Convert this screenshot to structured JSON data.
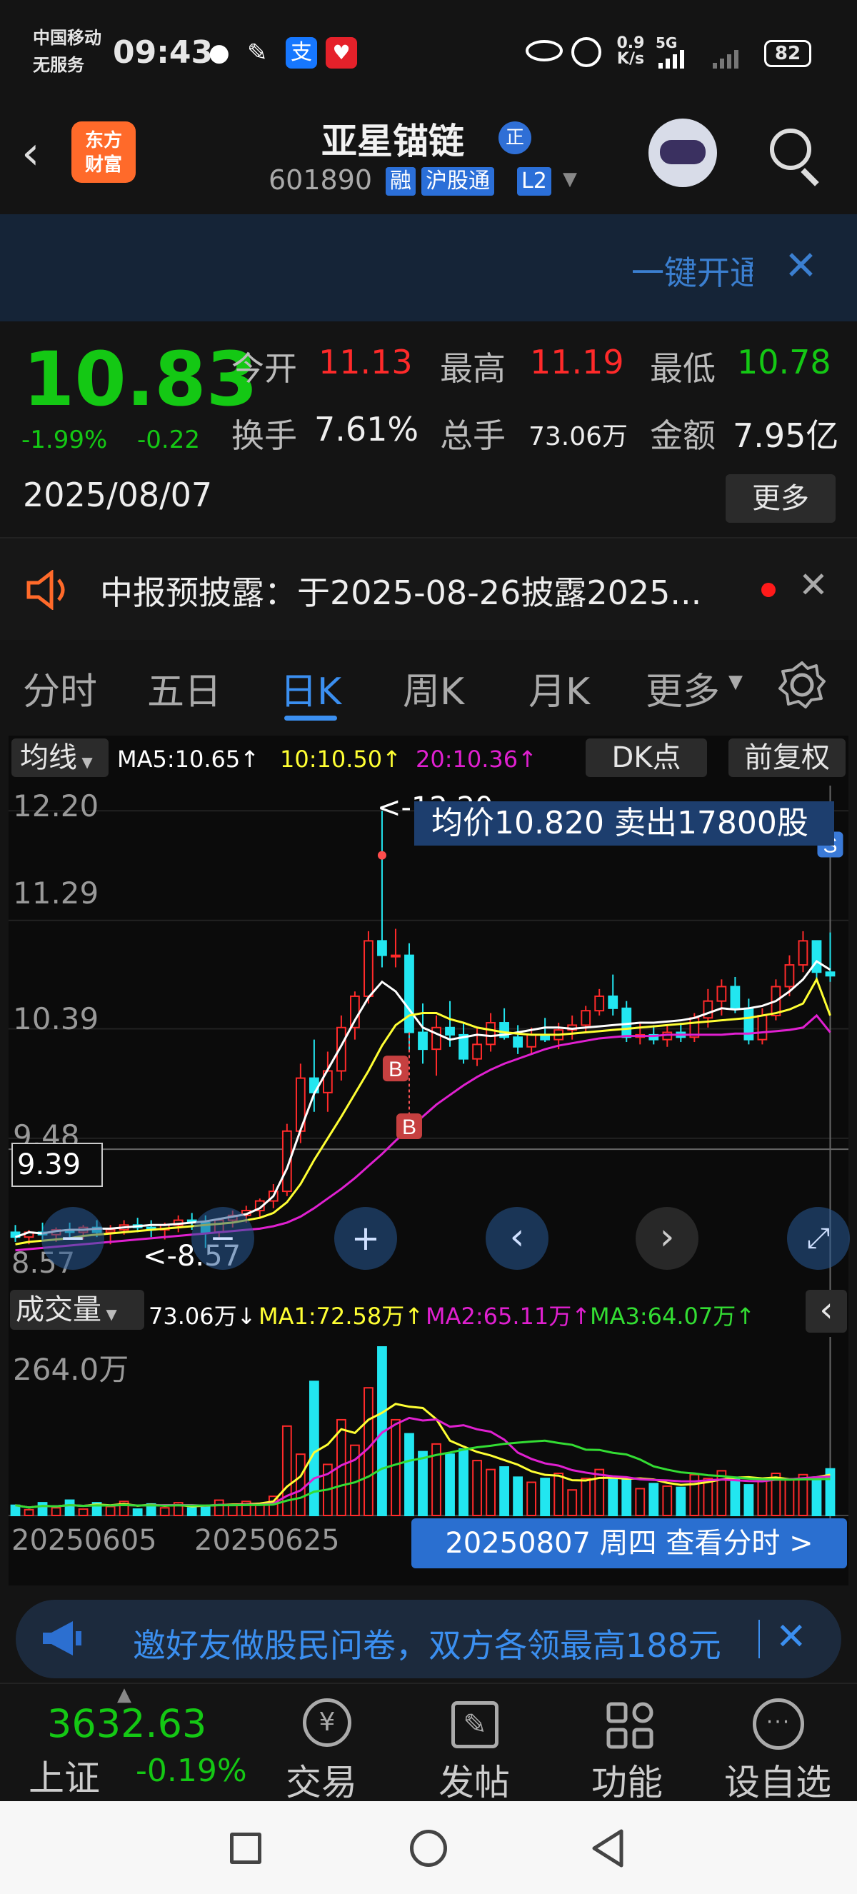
{
  "status": {
    "carrier": "中国移动",
    "service": "无服务",
    "time": "09:43",
    "speed_value": "0.9",
    "speed_unit": "K/s",
    "network": "5G",
    "battery": "82",
    "app_icons": [
      "wechat-icon",
      "feather-icon",
      "alipay-icon",
      "gift-icon"
    ]
  },
  "header": {
    "logo_line1": "东方",
    "logo_line2": "财富",
    "stock_name": "亚星锚链",
    "stock_badge": "正",
    "code": "601890",
    "tags": [
      "融",
      "沪股通",
      "L2"
    ]
  },
  "banner": {
    "text": "一键开通"
  },
  "quote": {
    "price": "10.83",
    "change_pct": "-1.99%",
    "change_amt": "-0.22",
    "open_label": "今开",
    "open": "11.13",
    "high_label": "最高",
    "high": "11.19",
    "low_label": "最低",
    "low": "10.78",
    "turnover_label": "换手",
    "turnover": "7.61%",
    "volume_label": "总手",
    "volume": "73.06万",
    "amount_label": "金额",
    "amount": "7.95亿",
    "date": "2025/08/07",
    "more_button": "更多"
  },
  "notice": {
    "text": "中报预披露：于2025-08-26披露2025..."
  },
  "tabs": [
    "分时",
    "五日",
    "日K",
    "周K",
    "月K",
    "更多"
  ],
  "active_tab": 2,
  "chart_toolbar": {
    "ma_select": "均线",
    "ma5": "MA5:10.65↑",
    "ma10": "10:10.50↑",
    "ma20": "20:10.36↑",
    "dk_button": "DK点",
    "fq_button": "前复权"
  },
  "price_chart": {
    "y_labels": [
      "12.20",
      "11.29",
      "10.39",
      "9.48"
    ],
    "crosshair_label": "9.39",
    "high_marker": "<-12.20",
    "low_marker": "<-8.57",
    "low_axis_label": "8.57",
    "trade_info": "均价10.820  卖出17800股",
    "buy_badge": "B",
    "sell_badge": "S"
  },
  "volume_toolbar": {
    "select": "成交量",
    "vol": "73.06万↓",
    "ma1": "MA1:72.58万↑",
    "ma2": "MA2:65.11万↑",
    "ma3": "MA3:64.07万↑"
  },
  "volume_chart": {
    "y_label": "264.0万"
  },
  "x_axis": {
    "date1": "20250605",
    "date2": "20250625",
    "view_button": "20250807 周四 查看分时 >"
  },
  "promo": {
    "text": "邀好友做股民问卷，双方各领最高188元"
  },
  "bottom_nav": {
    "index_value": "3632.63",
    "index_name": "上证",
    "index_change": "-0.19%",
    "items": [
      "交易",
      "发帖",
      "功能",
      "设自选"
    ]
  },
  "chart_data": {
    "type": "candlestick",
    "title": "",
    "ylim": [
      8.4,
      12.35
    ],
    "series": [
      {
        "name": "MA5",
        "values": [
          8.66,
          8.7,
          8.69,
          8.71,
          8.72,
          8.72,
          8.73,
          8.73,
          8.74,
          8.75,
          8.76,
          8.76,
          8.77,
          8.78,
          8.79,
          8.81,
          8.83,
          8.85,
          8.9,
          9.0,
          9.23,
          9.55,
          9.85,
          10.05,
          10.25,
          10.46,
          10.65,
          10.78,
          10.7,
          10.55,
          10.4,
          10.35,
          10.3,
          10.32,
          10.34,
          10.33,
          10.34,
          10.36,
          10.38,
          10.4,
          10.4,
          10.39,
          10.4,
          10.41,
          10.42,
          10.43,
          10.44,
          10.44,
          10.45,
          10.46,
          10.48,
          10.52,
          10.56,
          10.55,
          10.56,
          10.58,
          10.62,
          10.7,
          10.8,
          10.95,
          10.88
        ]
      },
      {
        "name": "MA10",
        "values": [
          8.6,
          8.62,
          8.63,
          8.64,
          8.65,
          8.67,
          8.68,
          8.69,
          8.7,
          8.71,
          8.72,
          8.73,
          8.74,
          8.75,
          8.76,
          8.77,
          8.78,
          8.8,
          8.82,
          8.86,
          8.95,
          9.1,
          9.3,
          9.48,
          9.66,
          9.85,
          10.04,
          10.25,
          10.42,
          10.5,
          10.52,
          10.52,
          10.47,
          10.44,
          10.4,
          10.38,
          10.36,
          10.35,
          10.34,
          10.34,
          10.34,
          10.35,
          10.36,
          10.37,
          10.38,
          10.39,
          10.4,
          10.41,
          10.42,
          10.43,
          10.44,
          10.45,
          10.46,
          10.47,
          10.48,
          10.5,
          10.52,
          10.55,
          10.6,
          10.8,
          10.5
        ]
      },
      {
        "name": "MA20",
        "values": [
          8.55,
          8.56,
          8.57,
          8.58,
          8.59,
          8.6,
          8.61,
          8.62,
          8.63,
          8.64,
          8.65,
          8.66,
          8.67,
          8.68,
          8.69,
          8.7,
          8.71,
          8.72,
          8.73,
          8.75,
          8.78,
          8.83,
          8.9,
          8.98,
          9.06,
          9.15,
          9.25,
          9.35,
          9.46,
          9.56,
          9.66,
          9.76,
          9.84,
          9.92,
          9.99,
          10.05,
          10.1,
          10.14,
          10.18,
          10.22,
          10.25,
          10.27,
          10.29,
          10.31,
          10.32,
          10.33,
          10.33,
          10.33,
          10.34,
          10.34,
          10.34,
          10.34,
          10.34,
          10.35,
          10.35,
          10.36,
          10.37,
          10.38,
          10.4,
          10.5,
          10.36
        ]
      }
    ],
    "volume": {
      "ylim": [
        0,
        264.0
      ],
      "ma_names": [
        "MA1",
        "MA2",
        "MA3"
      ]
    }
  }
}
